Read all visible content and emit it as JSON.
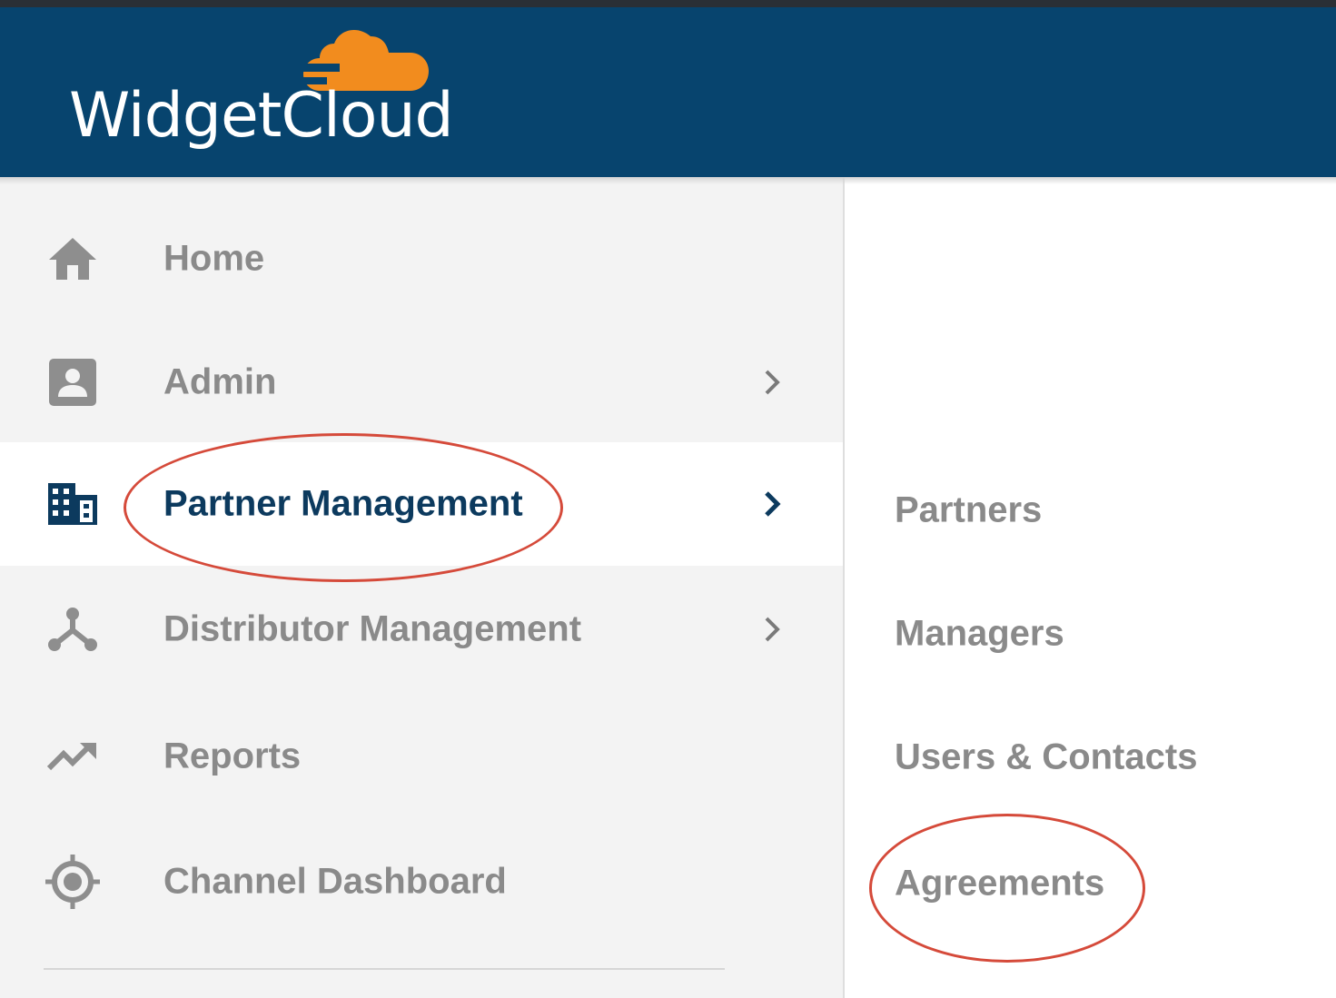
{
  "header": {
    "brand": "WidgetCloud",
    "background_color": "#07446e",
    "logo_icon": "cloud-icon",
    "logo_color": "#f28c1e"
  },
  "sidebar": {
    "items": [
      {
        "label": "Home",
        "icon": "home-icon",
        "has_submenu": false
      },
      {
        "label": "Admin",
        "icon": "user-card-icon",
        "has_submenu": true
      },
      {
        "label": "Partner Management",
        "icon": "building-icon",
        "has_submenu": true,
        "active": true
      },
      {
        "label": "Distributor Management",
        "icon": "hub-icon",
        "has_submenu": true
      },
      {
        "label": "Reports",
        "icon": "trending-up-icon",
        "has_submenu": false
      },
      {
        "label": "Channel Dashboard",
        "icon": "target-icon",
        "has_submenu": false
      }
    ],
    "active_text_color": "#0c3a5e",
    "text_color": "#8a8a8a"
  },
  "submenu": {
    "items": [
      {
        "label": "Partners"
      },
      {
        "label": "Managers"
      },
      {
        "label": "Users & Contacts"
      },
      {
        "label": "Agreements"
      }
    ]
  },
  "annotations": {
    "color": "#d54a3a",
    "circled": [
      "Partner Management",
      "Agreements"
    ]
  }
}
